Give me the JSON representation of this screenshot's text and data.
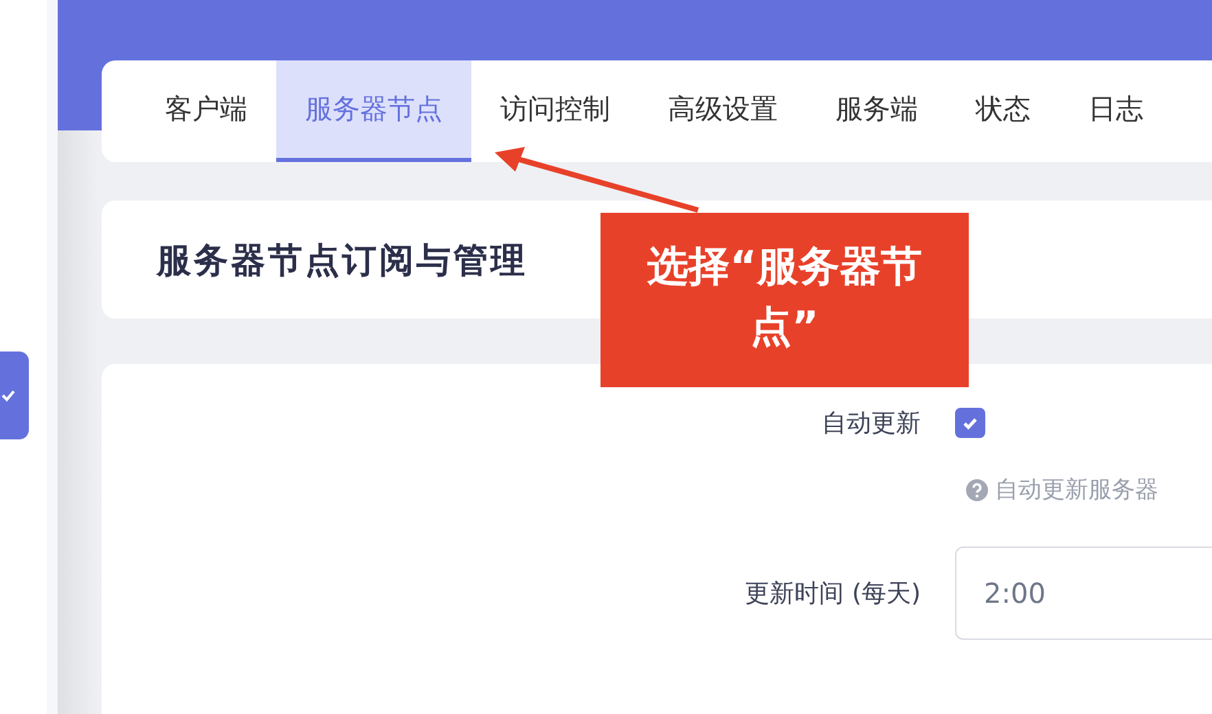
{
  "tabs": [
    {
      "label": "客户端",
      "selected": false
    },
    {
      "label": "服务器节点",
      "selected": true
    },
    {
      "label": "访问控制",
      "selected": false
    },
    {
      "label": "高级设置",
      "selected": false
    },
    {
      "label": "服务端",
      "selected": false
    },
    {
      "label": "状态",
      "selected": false
    },
    {
      "label": "日志",
      "selected": false
    }
  ],
  "section_title": "服务器节点订阅与管理",
  "callout": "选择“服务器节点”",
  "form": [
    {
      "kind": "checkbox",
      "label": "自动更新",
      "checked": true,
      "help": "自动更新服务器"
    },
    {
      "kind": "text",
      "label": "更新时间 (每天)",
      "value": "2:00"
    }
  ]
}
